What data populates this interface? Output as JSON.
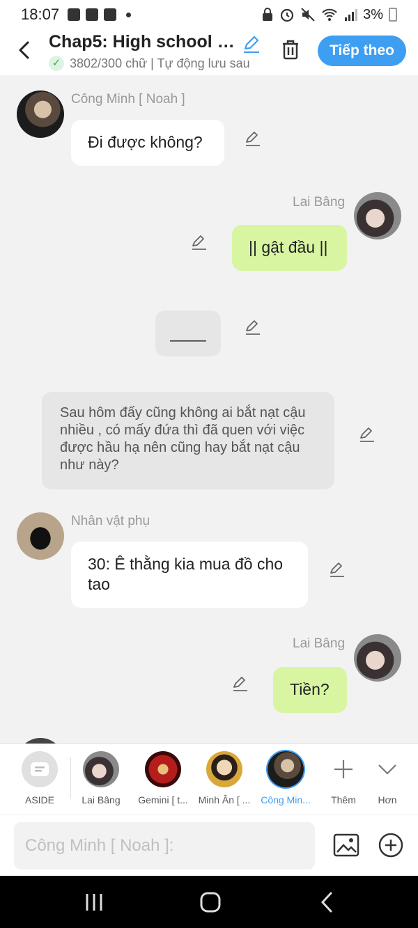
{
  "status_bar": {
    "time": "18:07",
    "battery": "3%"
  },
  "header": {
    "title": "Chap5: High school sw...",
    "subtitle": "3802/300 chữ | Tự động lưu sau",
    "next_button": "Tiếp theo"
  },
  "messages": [
    {
      "type": "left",
      "speaker": "Công Minh [ Noah ]",
      "text": "Đi được không?"
    },
    {
      "type": "right",
      "speaker": "Lai Bâng",
      "text": "|| gật đầu ||"
    },
    {
      "type": "center",
      "text": "____"
    },
    {
      "type": "narration",
      "text": "Sau hôm đấy cũng không ai bắt nạt cậu nhiều , có mấy đứa thì đã quen với việc được hầu hạ nên cũng hay bắt nạt cậu như này?"
    },
    {
      "type": "left",
      "speaker": "Nhân vật phụ",
      "text": "30: Ê thằng kia mua đồ cho tao"
    },
    {
      "type": "right",
      "speaker": "Lai Bâng",
      "text": "Tiền?"
    }
  ],
  "characters": [
    {
      "label": "ASIDE"
    },
    {
      "label": "Lai Bâng"
    },
    {
      "label": "Gemini [ t..."
    },
    {
      "label": "Minh Ân [ ..."
    },
    {
      "label": "Công Min..."
    }
  ],
  "more_options": [
    {
      "label": "Thêm"
    },
    {
      "label": "Hơn"
    }
  ],
  "input": {
    "placeholder": "Công Minh [ Noah ]:"
  },
  "colors": {
    "accent": "#3e9ef2",
    "green_bubble": "#d8f5a2"
  }
}
